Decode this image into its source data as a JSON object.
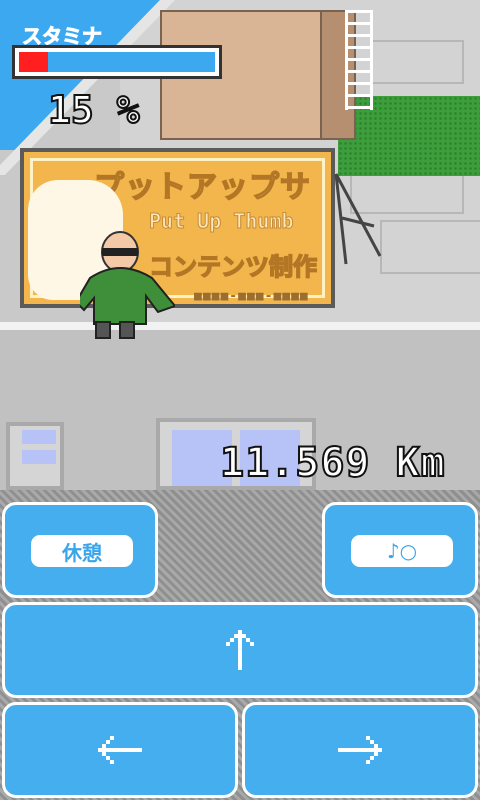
{
  "hud": {
    "stamina_label": "スタミナ",
    "stamina_value": 15,
    "stamina_percent_text": "15 %",
    "distance_text": "11.569 Km"
  },
  "sign": {
    "title_jp": "プットアップサム",
    "title_en": "Put Up Thumb",
    "subtitle_jp": "コンテンツ制作",
    "dashes": "■■■■-■■■-■■■■"
  },
  "controls": {
    "rest_label": "休憩",
    "sound_label": "♪○",
    "up_icon": "arrow-up-icon",
    "left_icon": "arrow-left-icon",
    "right_icon": "arrow-right-icon"
  },
  "colors": {
    "button_blue": "#45aeef",
    "stamina_red": "#ff1f1f",
    "stamina_blue": "#3ba8ef",
    "sign_orange": "#f3b64c"
  }
}
